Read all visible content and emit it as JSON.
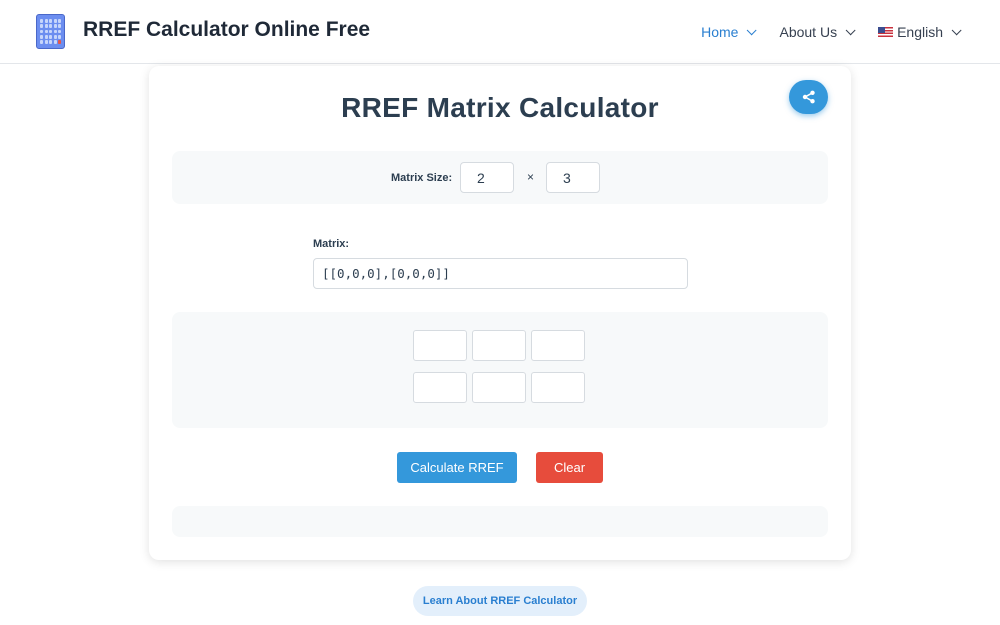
{
  "header": {
    "site_title": "RREF Calculator Online Free",
    "nav": [
      {
        "label": "Home",
        "active": true
      },
      {
        "label": "About Us",
        "active": false
      },
      {
        "label": "English",
        "active": false
      }
    ]
  },
  "card": {
    "title": "RREF Matrix Calculator",
    "matrix_size_label": "Matrix Size:",
    "rows": "2",
    "times": "×",
    "cols": "3",
    "matrix_label": "Matrix:",
    "matrix_value": "[[0,0,0],[0,0,0]]",
    "calculate_label": "Calculate RREF",
    "clear_label": "Clear"
  },
  "footer": {
    "learn_label": "Learn About RREF Calculator"
  },
  "icons": {
    "logo": "calculator-icon",
    "share": "share-icon",
    "flag": "us-flag-icon"
  },
  "colors": {
    "accent": "#3498db",
    "danger": "#e74c3c",
    "nav_active": "#2a7fd0"
  }
}
